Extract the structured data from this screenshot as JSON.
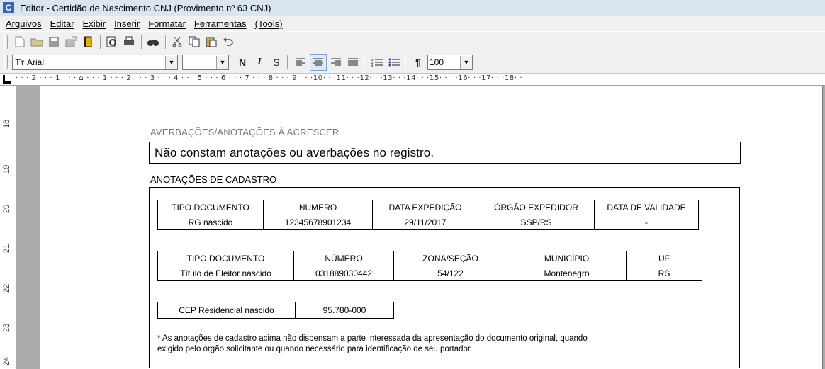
{
  "window": {
    "app_icon": "C",
    "title": "Editor - Certidão de Nascimento CNJ (Provimento nº 63 CNJ)"
  },
  "menu": [
    "Arquivos",
    "Editar",
    "Exibir",
    "Inserir",
    "Formatar",
    "Ferramentas",
    "(Tools)"
  ],
  "toolbar": {
    "icons": [
      "new-document-icon",
      "open-folder-icon",
      "save-icon",
      "export-icon",
      "book-icon",
      "print-preview-icon",
      "print-icon",
      "find-icon",
      "cut-icon",
      "copy-icon",
      "paste-icon",
      "undo-icon"
    ]
  },
  "format_bar": {
    "font_icon": "Ŧт",
    "font": "Arial",
    "size": "",
    "bold": "N",
    "italic": "I",
    "underline": "S",
    "pilcrow": "¶",
    "zoom": "100"
  },
  "ruler": {
    "text": "· · · 2 · · · 1 · · · ⌂ · · · 1 · · · 2 · · · 3 · · · 4 · · · 5 · · · 6 · · · 7 · · · 8 · · · 9 · · ·10· · ·11· · ·12· · ·13· · ·14· · ·15· · · ·16· · ·17· · ·18· ·"
  },
  "vruler": [
    "18",
    "19",
    "20",
    "21",
    "22",
    "23",
    "24"
  ],
  "document": {
    "averbacoes_title": "AVERBAÇÕES/ANOTAÇÕES À ACRESCER",
    "averbacoes_text": "Não constam anotações ou averbações no registro.",
    "cadastro_title": "ANOTAÇÕES DE CADASTRO",
    "rg_table": {
      "headers": [
        "TIPO DOCUMENTO",
        "NÚMERO",
        "DATA EXPEDIÇÃO",
        "ÓRGÃO EXPEDIDOR",
        "DATA DE VALIDADE"
      ],
      "row": [
        "RG nascido",
        "12345678901234",
        "29/11/2017",
        "SSP/RS",
        "-"
      ]
    },
    "titulo_table": {
      "headers": [
        "TIPO DOCUMENTO",
        "NÚMERO",
        "ZONA/SEÇÃO",
        "MUNICÍPIO",
        "UF"
      ],
      "row": [
        "Título de Eleitor nascido",
        "031889030442",
        "54/122",
        "Montenegro",
        "RS"
      ]
    },
    "cep": {
      "label": "CEP Residencial nascido",
      "value": "95.780-000"
    },
    "note_line1": "* As anotações de cadastro acima não dispensam a parte interessada da apresentação do documento original, quando",
    "note_line2": "exigido pelo órgão solicitante ou quando necessário para identificação de seu portador."
  }
}
